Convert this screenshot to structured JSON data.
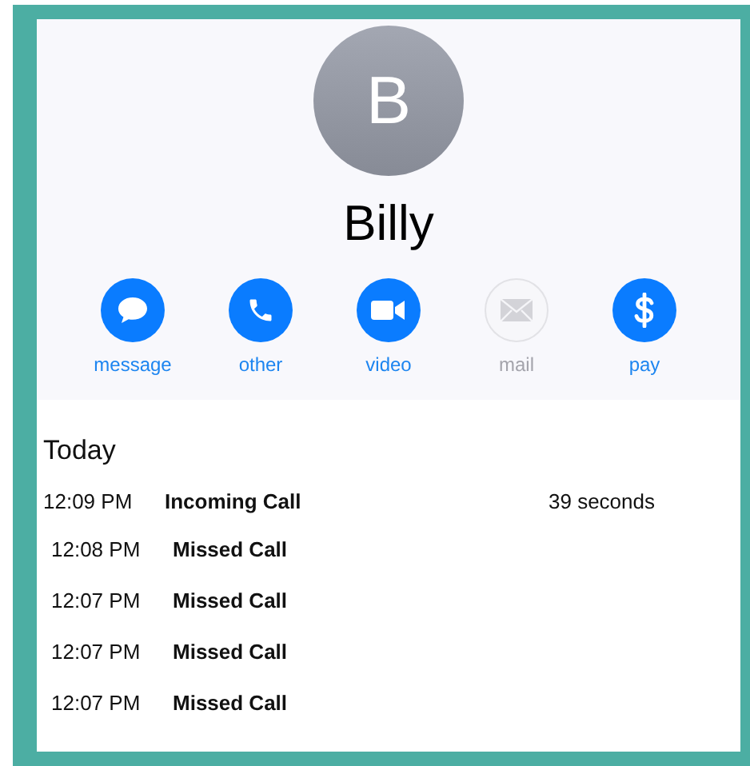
{
  "contact": {
    "initial": "B",
    "name": "Billy"
  },
  "actions": [
    {
      "kind": "message",
      "label": "message",
      "disabled": false
    },
    {
      "kind": "phone",
      "label": "other",
      "disabled": false
    },
    {
      "kind": "video",
      "label": "video",
      "disabled": false
    },
    {
      "kind": "mail",
      "label": "mail",
      "disabled": true
    },
    {
      "kind": "pay",
      "label": "pay",
      "disabled": false
    }
  ],
  "history": {
    "heading": "Today",
    "calls": [
      {
        "time": "12:09 PM",
        "type": "Incoming Call",
        "duration": "39 seconds"
      },
      {
        "time": "12:08 PM",
        "type": "Missed Call"
      },
      {
        "time": "12:07 PM",
        "type": "Missed Call"
      },
      {
        "time": "12:07 PM",
        "type": "Missed Call"
      },
      {
        "time": "12:07 PM",
        "type": "Missed Call"
      }
    ]
  }
}
